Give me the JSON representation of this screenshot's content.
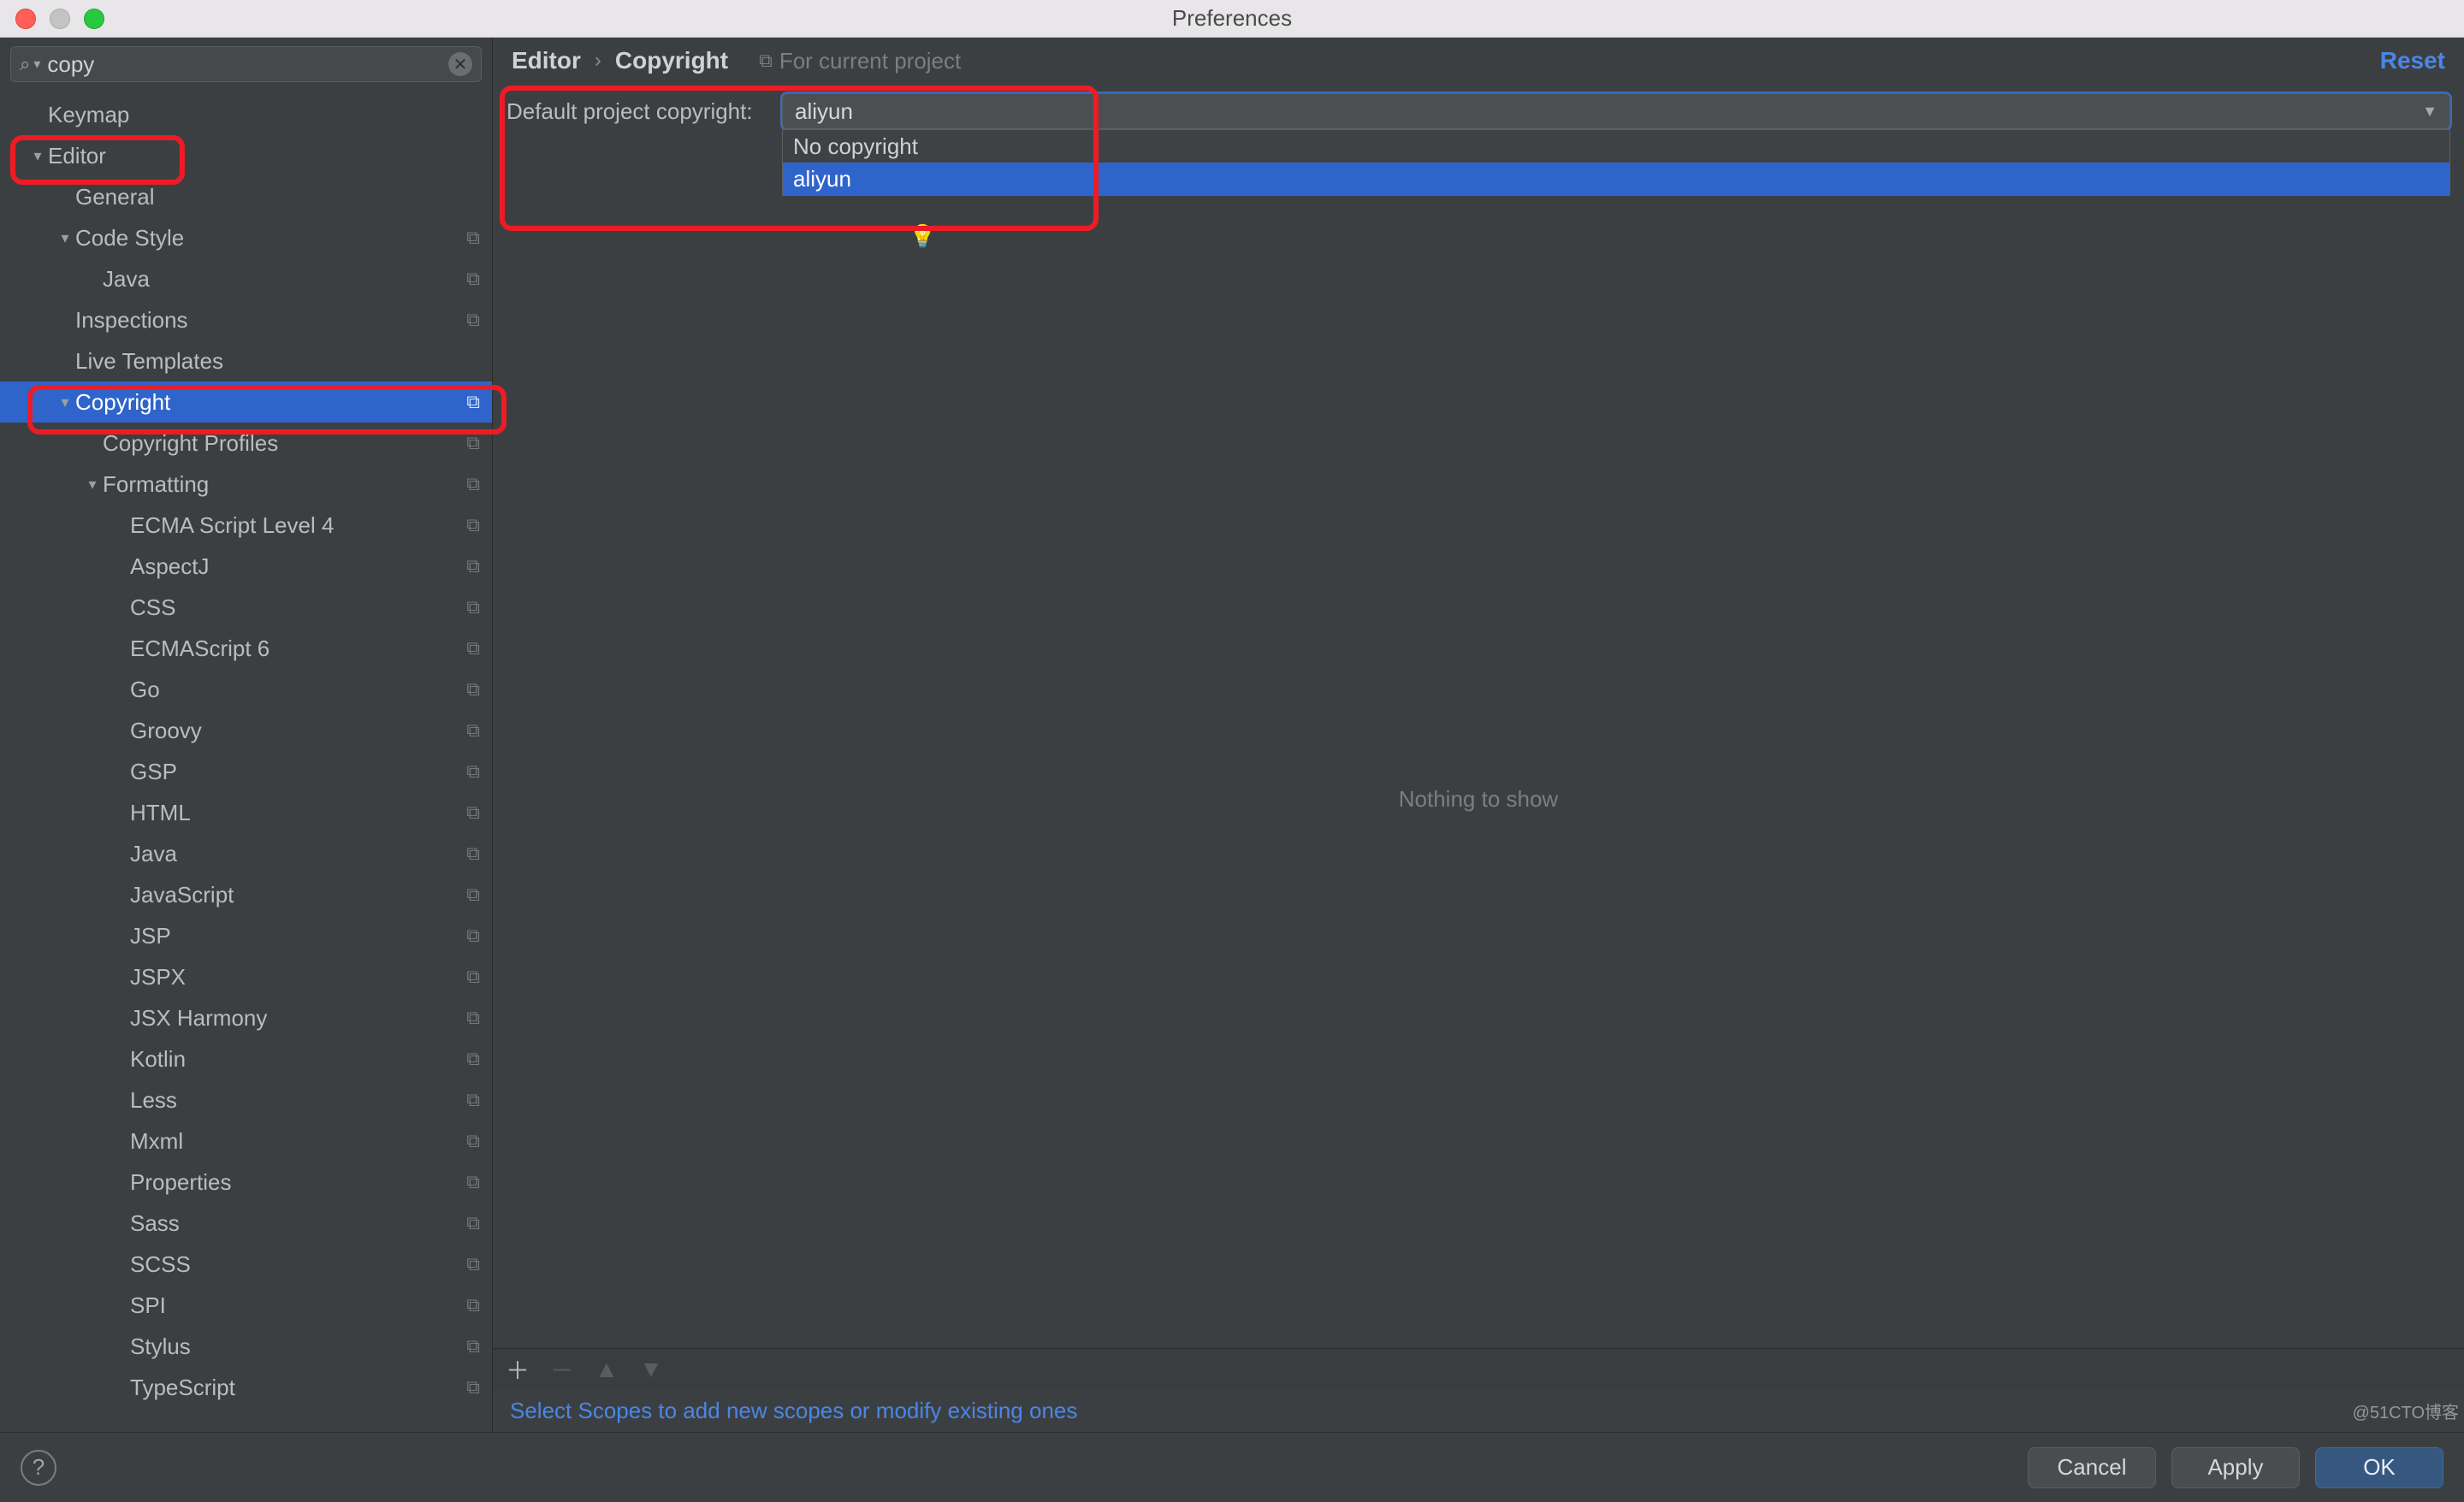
{
  "window": {
    "title": "Preferences"
  },
  "search": {
    "value": "copy"
  },
  "sidebar": {
    "items": [
      {
        "label": "Keymap",
        "depth": 0,
        "expandable": false,
        "profile": false
      },
      {
        "label": "Editor",
        "depth": 0,
        "expandable": true,
        "profile": false,
        "highlight": true
      },
      {
        "label": "General",
        "depth": 1,
        "expandable": false,
        "profile": false
      },
      {
        "label": "Code Style",
        "depth": 1,
        "expandable": true,
        "profile": true
      },
      {
        "label": "Java",
        "depth": 2,
        "expandable": false,
        "profile": true
      },
      {
        "label": "Inspections",
        "depth": 1,
        "expandable": false,
        "profile": true
      },
      {
        "label": "Live Templates",
        "depth": 1,
        "expandable": false,
        "profile": false
      },
      {
        "label": "Copyright",
        "depth": 1,
        "expandable": true,
        "profile": true,
        "selected": true,
        "highlight": true
      },
      {
        "label": "Copyright Profiles",
        "depth": 2,
        "expandable": false,
        "profile": true
      },
      {
        "label": "Formatting",
        "depth": 2,
        "expandable": true,
        "profile": true
      },
      {
        "label": "ECMA Script Level 4",
        "depth": 3,
        "expandable": false,
        "profile": true
      },
      {
        "label": "AspectJ",
        "depth": 3,
        "expandable": false,
        "profile": true
      },
      {
        "label": "CSS",
        "depth": 3,
        "expandable": false,
        "profile": true
      },
      {
        "label": "ECMAScript 6",
        "depth": 3,
        "expandable": false,
        "profile": true
      },
      {
        "label": "Go",
        "depth": 3,
        "expandable": false,
        "profile": true
      },
      {
        "label": "Groovy",
        "depth": 3,
        "expandable": false,
        "profile": true
      },
      {
        "label": "GSP",
        "depth": 3,
        "expandable": false,
        "profile": true
      },
      {
        "label": "HTML",
        "depth": 3,
        "expandable": false,
        "profile": true
      },
      {
        "label": "Java",
        "depth": 3,
        "expandable": false,
        "profile": true
      },
      {
        "label": "JavaScript",
        "depth": 3,
        "expandable": false,
        "profile": true
      },
      {
        "label": "JSP",
        "depth": 3,
        "expandable": false,
        "profile": true
      },
      {
        "label": "JSPX",
        "depth": 3,
        "expandable": false,
        "profile": true
      },
      {
        "label": "JSX Harmony",
        "depth": 3,
        "expandable": false,
        "profile": true
      },
      {
        "label": "Kotlin",
        "depth": 3,
        "expandable": false,
        "profile": true
      },
      {
        "label": "Less",
        "depth": 3,
        "expandable": false,
        "profile": true
      },
      {
        "label": "Mxml",
        "depth": 3,
        "expandable": false,
        "profile": true
      },
      {
        "label": "Properties",
        "depth": 3,
        "expandable": false,
        "profile": true
      },
      {
        "label": "Sass",
        "depth": 3,
        "expandable": false,
        "profile": true
      },
      {
        "label": "SCSS",
        "depth": 3,
        "expandable": false,
        "profile": true
      },
      {
        "label": "SPI",
        "depth": 3,
        "expandable": false,
        "profile": true
      },
      {
        "label": "Stylus",
        "depth": 3,
        "expandable": false,
        "profile": true
      },
      {
        "label": "TypeScript",
        "depth": 3,
        "expandable": false,
        "profile": true
      }
    ]
  },
  "breadcrumb": {
    "root": "Editor",
    "leaf": "Copyright",
    "note": "For current project"
  },
  "reset_label": "Reset",
  "settings": {
    "label": "Default project copyright:",
    "value": "aliyun",
    "options": [
      {
        "label": "No copyright",
        "selected": false
      },
      {
        "label": "aliyun",
        "selected": true
      }
    ]
  },
  "empty_text": "Nothing to show",
  "hint": "Select Scopes to add new scopes or modify existing ones",
  "footer": {
    "cancel": "Cancel",
    "apply": "Apply",
    "ok": "OK",
    "help": "?"
  },
  "watermark": "@51CTO博客"
}
